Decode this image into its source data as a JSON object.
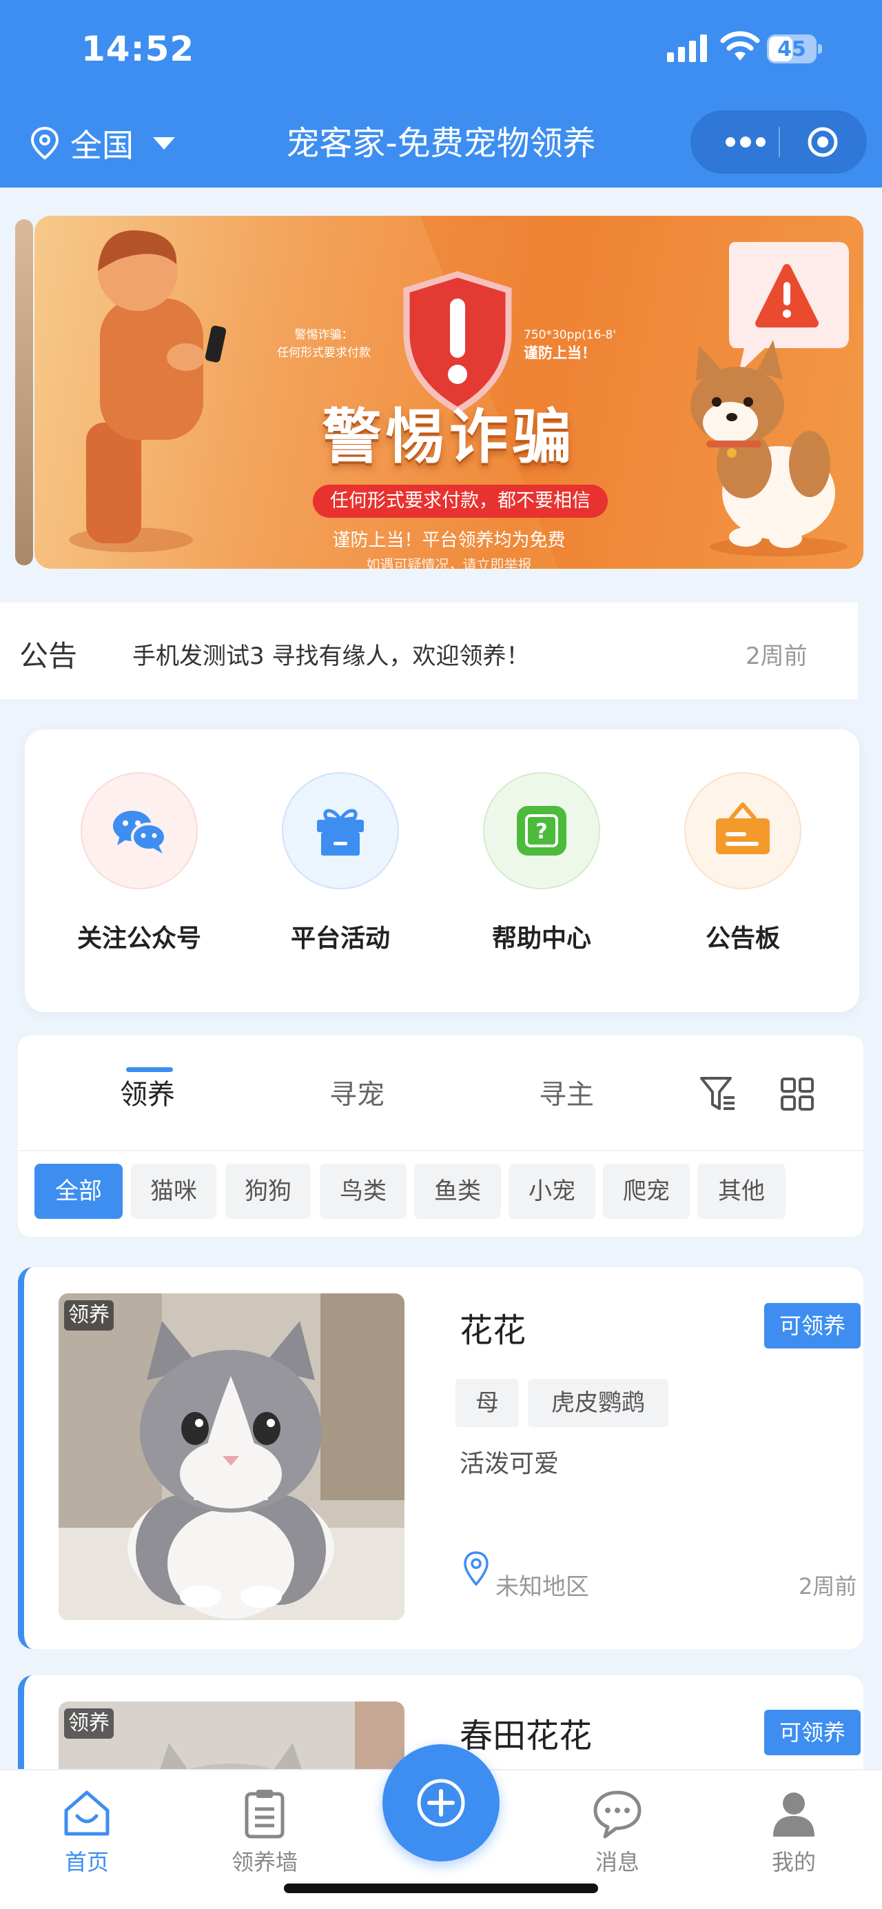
{
  "status_bar": {
    "time": "14:52",
    "battery": "45"
  },
  "header": {
    "location": "全国",
    "title": "宠客家-免费宠物领养"
  },
  "banner": {
    "title": "警惕诈骗",
    "pill": "任何形式要求付款，都不要相信",
    "line1": "谨防上当！平台领养均为免费",
    "line2": "如遇可疑情况，请立即举报",
    "note_left_1": "警惕诈骗：",
    "note_left_2": "任何形式要求付款",
    "note_right_1": "750*30pp(16-8'",
    "note_right_2": "谨防上当！"
  },
  "notice": {
    "label": "公告",
    "text": "手机发测试3 寻找有缘人，欢迎领养！",
    "time": "2周前"
  },
  "quick_menu": [
    {
      "label": "关注公众号",
      "icon": "wechat-icon",
      "color": "#3d8ef0"
    },
    {
      "label": "平台活动",
      "icon": "gift-icon",
      "color": "#3d8ef0"
    },
    {
      "label": "帮助中心",
      "icon": "help-icon",
      "color": "#4cbb3c"
    },
    {
      "label": "公告板",
      "icon": "board-icon",
      "color": "#f39a2b"
    }
  ],
  "tabs": [
    {
      "label": "领养",
      "active": true
    },
    {
      "label": "寻宠",
      "active": false
    },
    {
      "label": "寻主",
      "active": false
    }
  ],
  "chips": [
    "全部",
    "猫咪",
    "狗狗",
    "鸟类",
    "鱼类",
    "小宠",
    "爬宠",
    "其他"
  ],
  "pets": [
    {
      "tag": "领养",
      "name": "花花",
      "status": "可领养",
      "attrs": [
        "母",
        "虎皮鹦鹉"
      ],
      "desc": "活泼可爱",
      "location": "未知地区",
      "time": "2周前"
    },
    {
      "tag": "领养",
      "name": "春田花花",
      "status": "可领养"
    }
  ],
  "bottom_nav": [
    {
      "label": "首页",
      "icon": "home-icon",
      "active": true
    },
    {
      "label": "领养墙",
      "icon": "clipboard-icon",
      "active": false
    },
    {
      "label": "消息",
      "icon": "chat-icon",
      "active": false
    },
    {
      "label": "我的",
      "icon": "user-icon",
      "active": false
    }
  ],
  "colors": {
    "primary": "#3d8ef0",
    "background": "#eef4fb"
  }
}
